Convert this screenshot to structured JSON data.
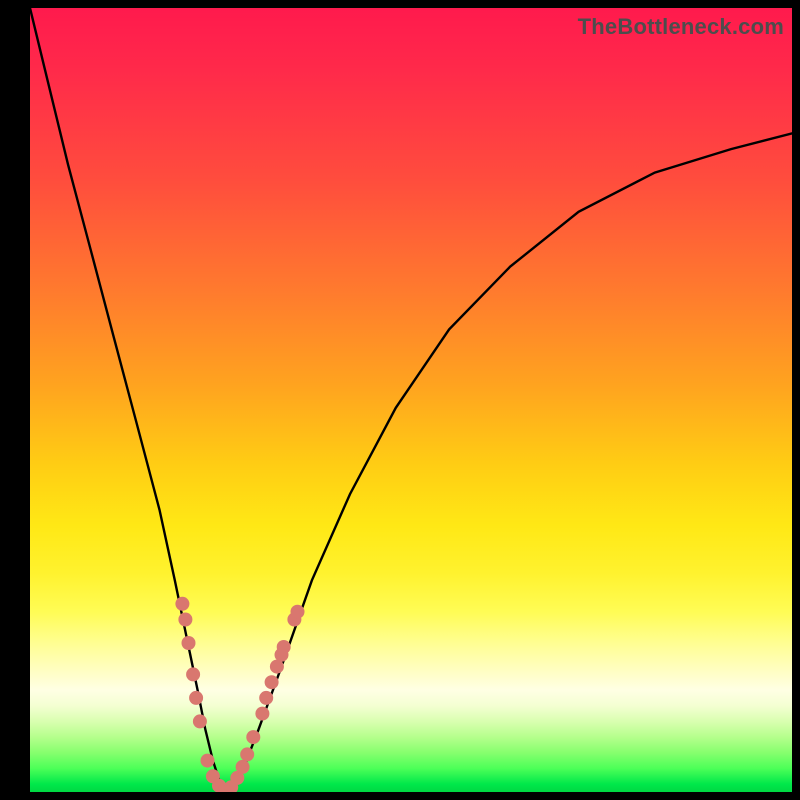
{
  "watermark": "TheBottleneck.com",
  "colors": {
    "frame": "#000000",
    "curve": "#000000",
    "markers": "#d9776f",
    "gradient_stops": [
      "#ff1a4d",
      "#ff4d3d",
      "#ff7a2e",
      "#ffa31f",
      "#ffcc14",
      "#ffe815",
      "#fffc55",
      "#fffec2",
      "#d9ffb0",
      "#4cff58",
      "#00d843"
    ]
  },
  "chart_data": {
    "type": "line",
    "title": "",
    "xlabel": "",
    "ylabel": "",
    "xlim": [
      0,
      100
    ],
    "ylim": [
      0,
      100
    ],
    "grid": false,
    "legend": false,
    "annotations": [
      "TheBottleneck.com"
    ],
    "series": [
      {
        "name": "bottleneck-curve",
        "x": [
          0,
          2,
          5,
          8,
          11,
          14,
          17,
          19,
          20.5,
          22,
          23,
          24,
          25,
          26,
          27,
          28,
          30,
          33,
          37,
          42,
          48,
          55,
          63,
          72,
          82,
          92,
          100
        ],
        "y": [
          100,
          92,
          80,
          69,
          58,
          47,
          36,
          27,
          20,
          13,
          8,
          4,
          1,
          0,
          1,
          3,
          8,
          16,
          27,
          38,
          49,
          59,
          67,
          74,
          79,
          82,
          84
        ]
      }
    ],
    "markers": [
      {
        "x": 20.0,
        "y": 24
      },
      {
        "x": 20.4,
        "y": 22
      },
      {
        "x": 20.8,
        "y": 19
      },
      {
        "x": 21.4,
        "y": 15
      },
      {
        "x": 21.8,
        "y": 12
      },
      {
        "x": 22.3,
        "y": 9
      },
      {
        "x": 23.3,
        "y": 4
      },
      {
        "x": 24.0,
        "y": 2
      },
      {
        "x": 24.8,
        "y": 0.8
      },
      {
        "x": 25.6,
        "y": 0.3
      },
      {
        "x": 26.4,
        "y": 0.6
      },
      {
        "x": 27.2,
        "y": 1.8
      },
      {
        "x": 27.9,
        "y": 3.2
      },
      {
        "x": 28.5,
        "y": 4.8
      },
      {
        "x": 29.3,
        "y": 7
      },
      {
        "x": 30.5,
        "y": 10
      },
      {
        "x": 31.0,
        "y": 12
      },
      {
        "x": 31.7,
        "y": 14
      },
      {
        "x": 32.4,
        "y": 16
      },
      {
        "x": 33.0,
        "y": 17.5
      },
      {
        "x": 33.3,
        "y": 18.5
      },
      {
        "x": 34.7,
        "y": 22
      },
      {
        "x": 35.1,
        "y": 23
      }
    ]
  }
}
